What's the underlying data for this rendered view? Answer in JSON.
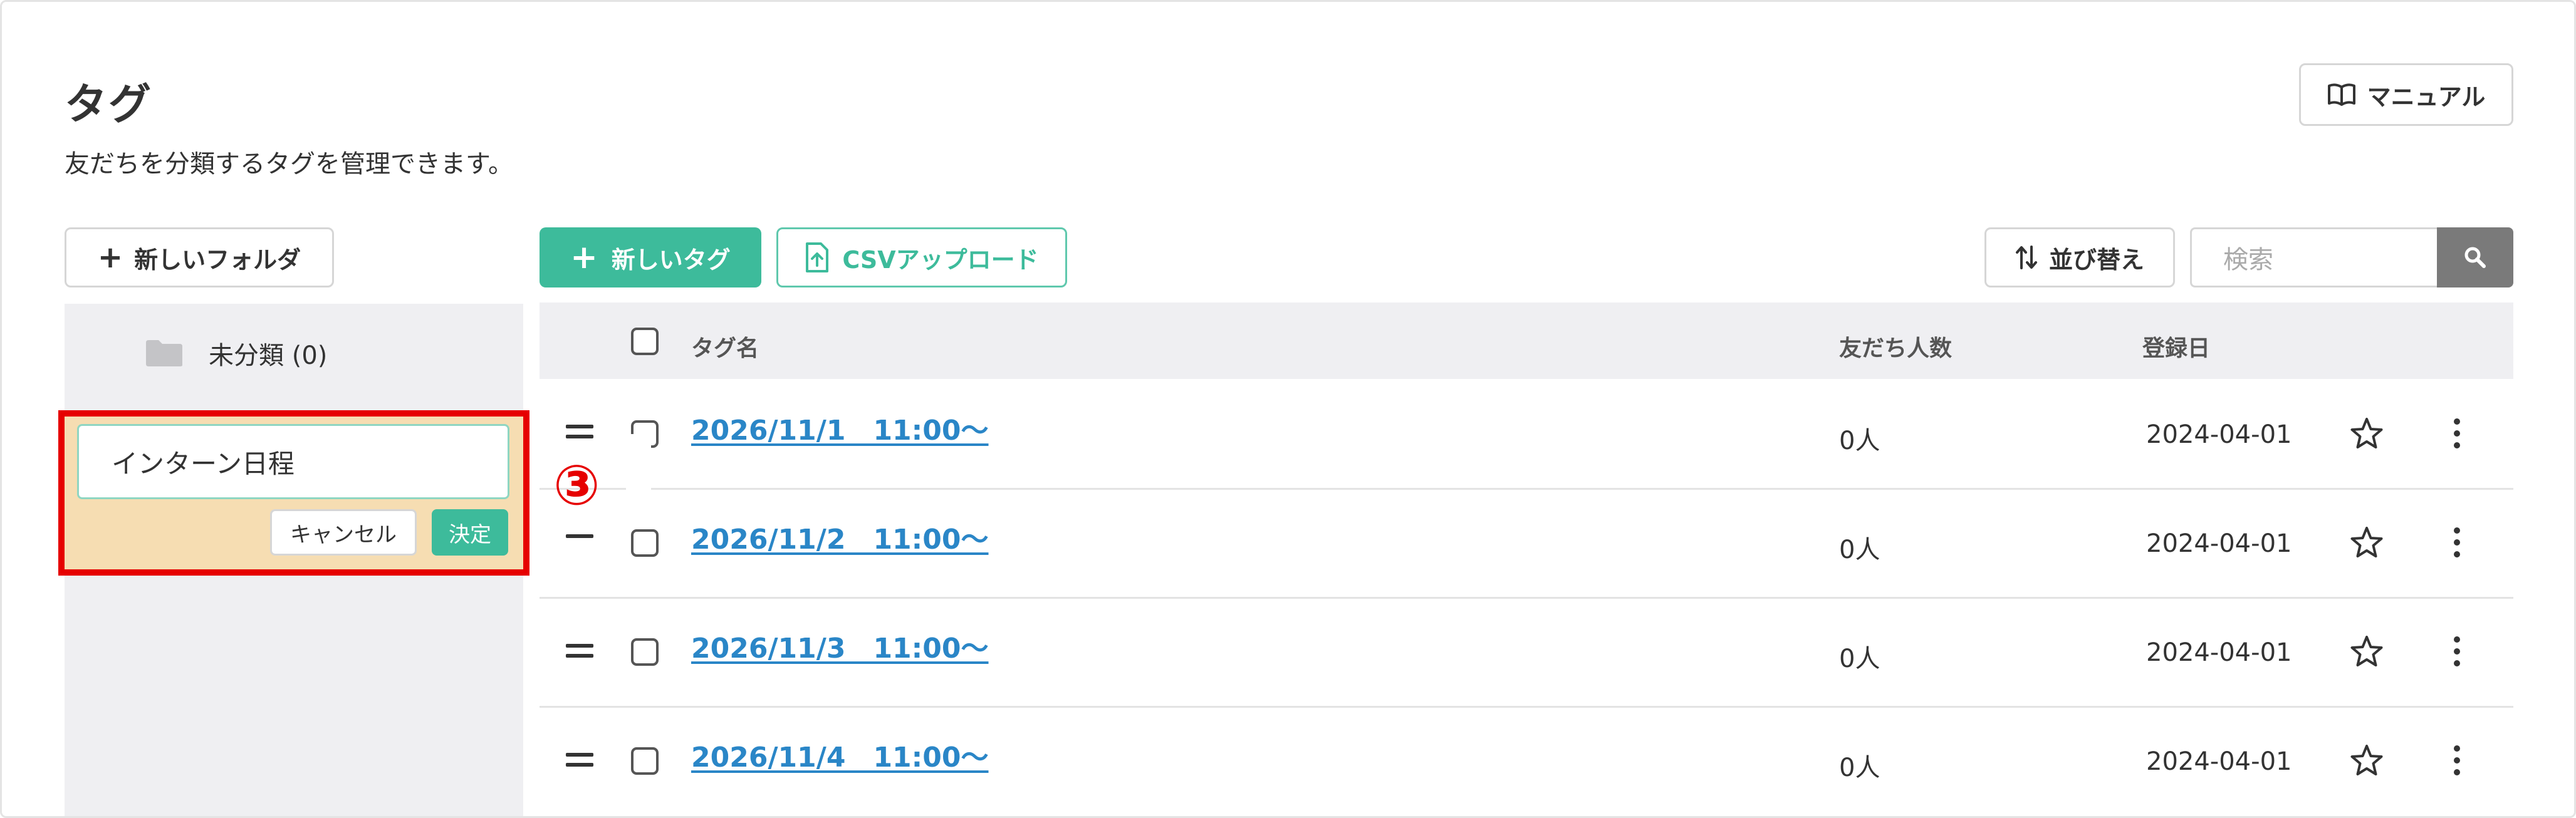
{
  "page": {
    "title": "タグ",
    "subtitle": "友だちを分類するタグを管理できます。",
    "manual_label": "マニュアル"
  },
  "toolbar": {
    "new_folder_label": "新しいフォルダ",
    "new_tag_label": "新しいタグ",
    "csv_upload_label": "CSVアップロード",
    "sort_label": "並び替え",
    "search_placeholder": "検索"
  },
  "sidebar": {
    "folders": [
      {
        "label": "未分類 (0)"
      }
    ],
    "edit": {
      "value": "インターン日程",
      "cancel_label": "キャンセル",
      "confirm_label": "決定"
    }
  },
  "annotation": {
    "marker": "③",
    "color": "#e60000"
  },
  "table": {
    "headers": {
      "name": "タグ名",
      "friends": "友だち人数",
      "registered": "登録日"
    },
    "rows": [
      {
        "name": "2026/11/1　11:00〜",
        "friends": "0人",
        "date": "2024-04-01"
      },
      {
        "name": "2026/11/2　11:00〜",
        "friends": "0人",
        "date": "2024-04-01"
      },
      {
        "name": "2026/11/3　11:00〜",
        "friends": "0人",
        "date": "2024-04-01"
      },
      {
        "name": "2026/11/4　11:00〜",
        "friends": "0人",
        "date": "2024-04-01"
      }
    ]
  },
  "colors": {
    "accent": "#3dbb9b",
    "link": "#2a86c7",
    "highlight": "#f6ddb2"
  }
}
